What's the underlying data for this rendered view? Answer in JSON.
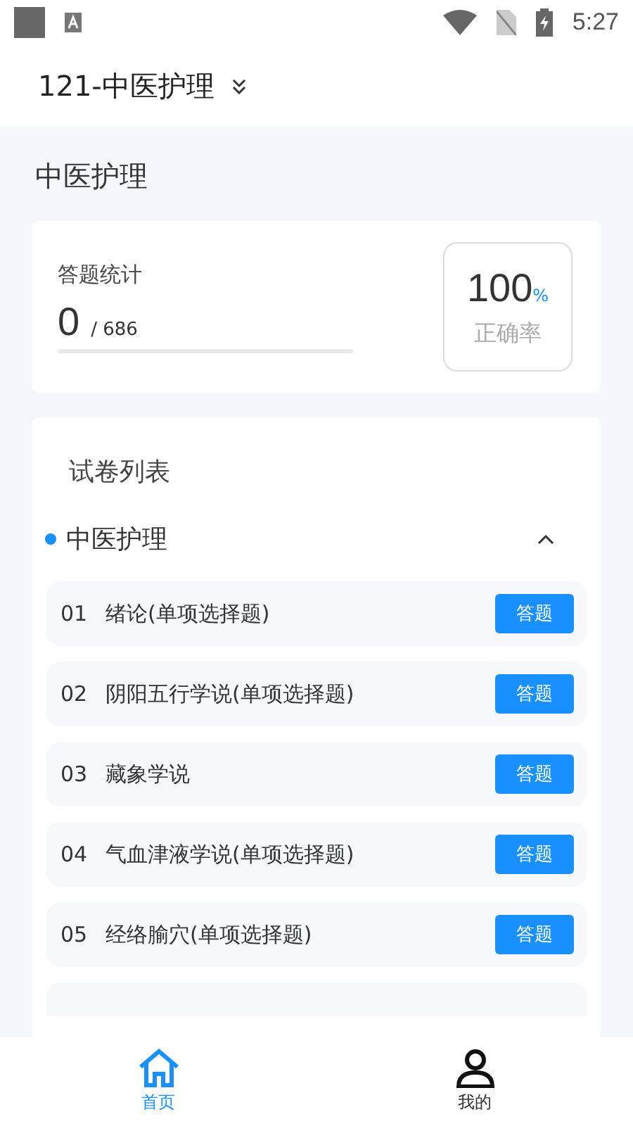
{
  "status_bar": {
    "time": "5:27"
  },
  "header": {
    "title": "121-中医护理"
  },
  "page_title": "中医护理",
  "stats": {
    "label": "答题统计",
    "answered": "0",
    "total": "/ 686",
    "level": 0,
    "rate": "100",
    "rate_unit": "%",
    "rate_label": "正确率"
  },
  "paper_list": {
    "title": "试卷列表",
    "section": {
      "name": "中医护理",
      "expanded": true
    },
    "papers": [
      {
        "number": "01",
        "name": "绪论(单项选择题)",
        "action": "答题"
      },
      {
        "number": "02",
        "name": "阴阳五行学说(单项选择题)",
        "action": "答题"
      },
      {
        "number": "03",
        "name": "藏象学说",
        "action": "答题"
      },
      {
        "number": "04",
        "name": "气血津液学说(单项选择题)",
        "action": "答题"
      },
      {
        "number": "05",
        "name": "经络腧穴(单项选择题)",
        "action": "答题"
      }
    ]
  },
  "tab_bar": [
    {
      "label": "首页",
      "kind": "home",
      "selected": true
    },
    {
      "label": "我的",
      "kind": "profile",
      "selected": false
    }
  ]
}
